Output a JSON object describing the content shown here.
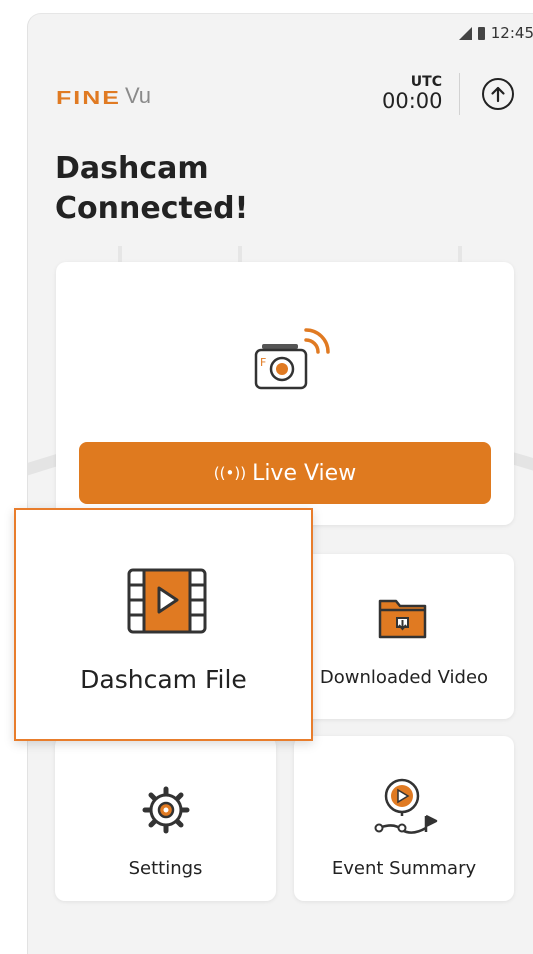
{
  "status_bar": {
    "time": "12:45"
  },
  "header": {
    "logo_fine": "FINE",
    "logo_vu": "Vu",
    "utc_label": "UTC",
    "utc_time": "00:00"
  },
  "title_line1": "Dashcam",
  "title_line2": "Connected!",
  "live_view": {
    "label": "Live View"
  },
  "tiles": {
    "dashcam_file": "Dashcam File",
    "downloaded_video": "Downloaded Video",
    "settings": "Settings",
    "event_summary": "Event Summary"
  },
  "colors": {
    "accent": "#df7a1f",
    "background": "#f3f3f3",
    "card": "#ffffff",
    "focus_border": "#e87d2c"
  },
  "icons": [
    "upload-icon",
    "camera-wifi-icon",
    "live-signal-icon",
    "film-play-icon",
    "folder-download-icon",
    "gear-icon",
    "route-play-icon"
  ]
}
